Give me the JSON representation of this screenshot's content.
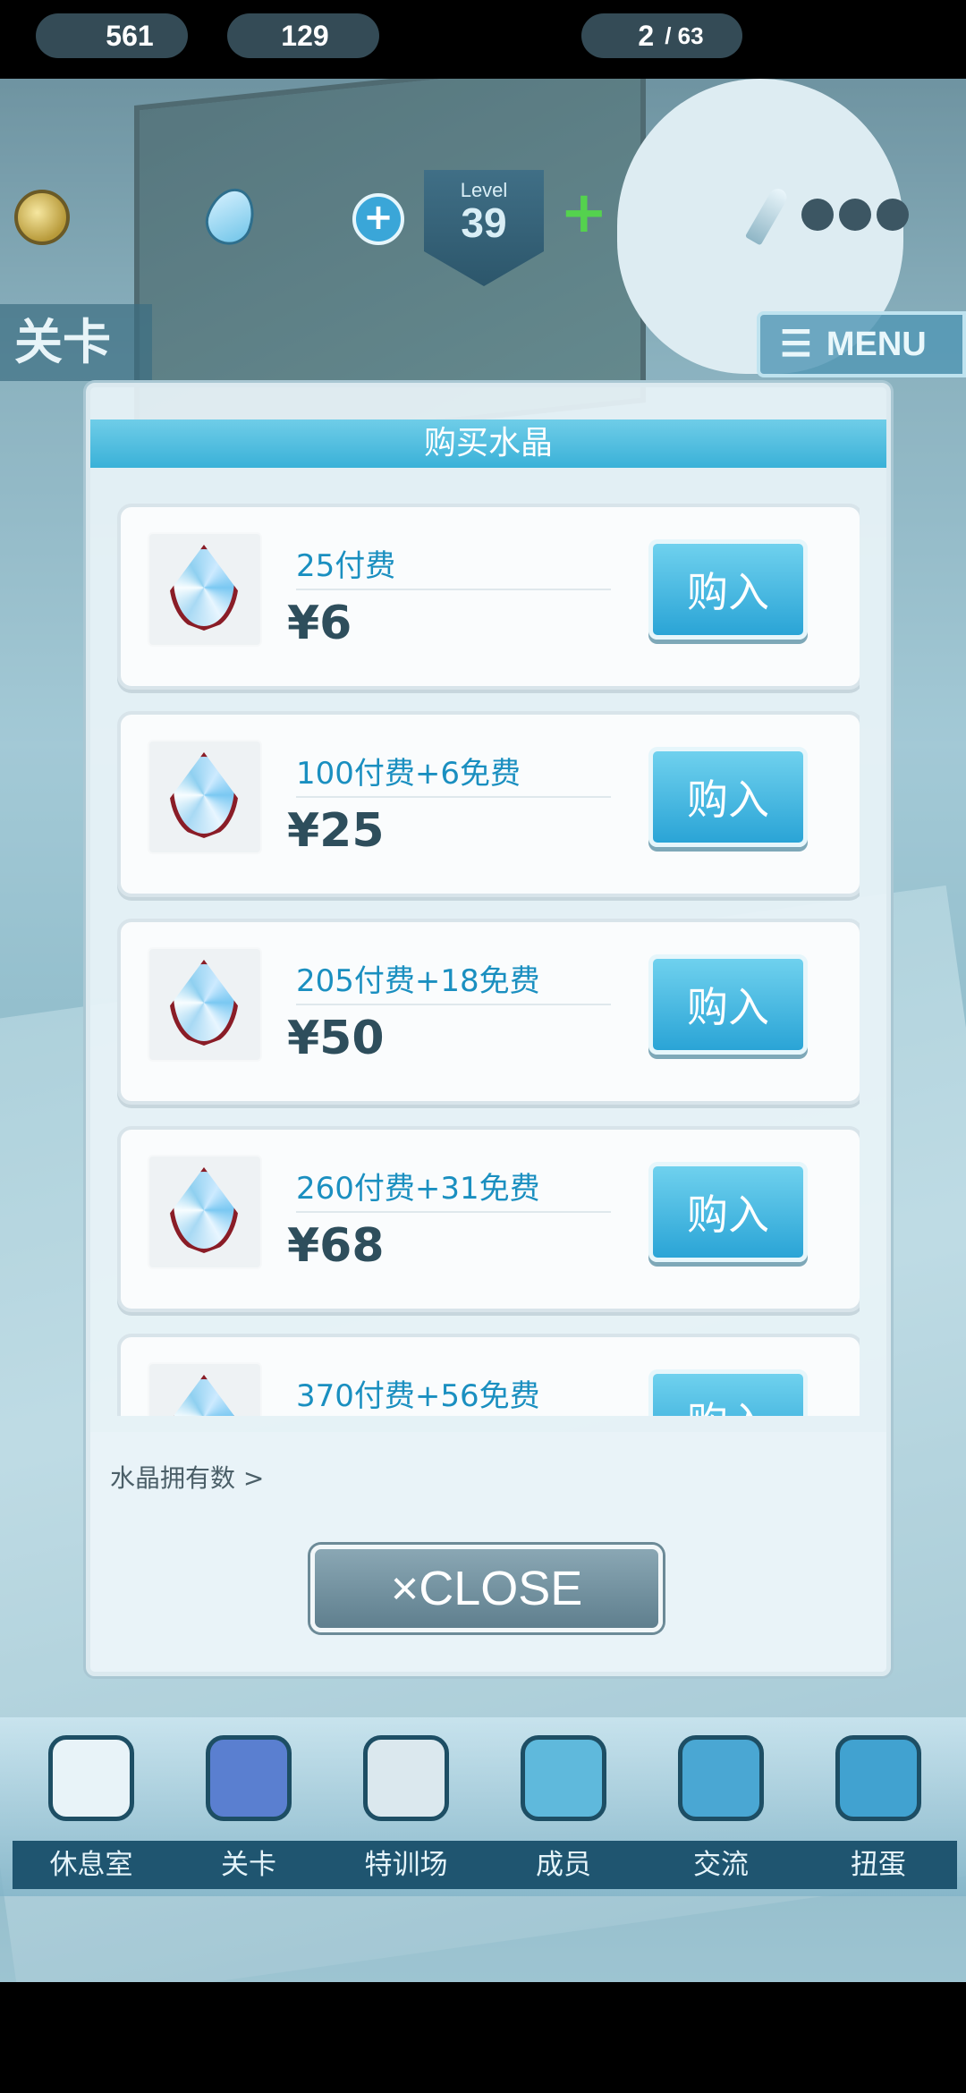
{
  "topbar": {
    "coins": "561",
    "crystals": "129",
    "level_label": "Level",
    "level_value": "39",
    "stamina_current": "2",
    "stamina_max": "/ 63"
  },
  "header": {
    "stage_title": "关卡",
    "menu_label": "MENU"
  },
  "modal": {
    "title": "购买水晶",
    "items": [
      {
        "desc": "25付费",
        "price": "¥6",
        "button": "购入"
      },
      {
        "desc": "100付费+6免费",
        "price": "¥25",
        "button": "购入"
      },
      {
        "desc": "205付费+18免费",
        "price": "¥50",
        "button": "购入"
      },
      {
        "desc": "260付费+31免费",
        "price": "¥68",
        "button": "购入"
      },
      {
        "desc": "370付费+56免费",
        "price": "",
        "button": "购入"
      }
    ],
    "owned_label": "水晶拥有数 >",
    "close_label": "×CLOSE"
  },
  "bottom_nav": [
    {
      "label": "休息室",
      "icon": "building-icon"
    },
    {
      "label": "关卡",
      "icon": "monster-icon"
    },
    {
      "label": "特训场",
      "icon": "crossed-swords-icon"
    },
    {
      "label": "成员",
      "icon": "member-icon"
    },
    {
      "label": "交流",
      "icon": "coat-icon"
    },
    {
      "label": "扭蛋",
      "icon": "curtain-icon"
    }
  ],
  "colors": {
    "accent": "#3ab1d8",
    "price_text": "#2e4e5c",
    "desc_text": "#1a8fc0"
  }
}
